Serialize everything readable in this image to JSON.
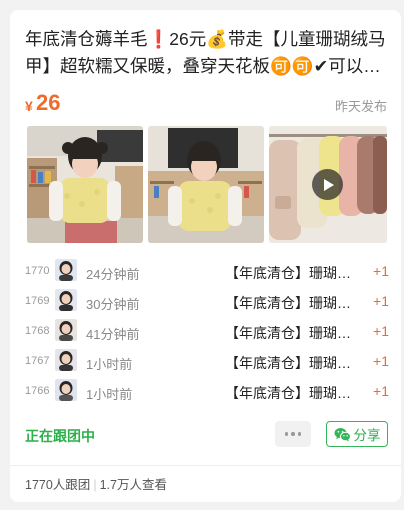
{
  "post": {
    "title": "年底清仓薅羊毛❗26元💰带走【儿童珊瑚绒马甲】超软糯又保暖，叠穿天花板🉑🉑✔可以直接穿也可以叠穿",
    "price_currency": "¥",
    "price_value": "26",
    "publish_time": "昨天发布"
  },
  "images": [
    {
      "name": "photo-child-front"
    },
    {
      "name": "photo-child-side"
    },
    {
      "name": "video-vests-rack",
      "is_video": true
    }
  ],
  "orders": [
    {
      "num": "1770",
      "time": "24分钟前",
      "item": "【年底清仓】珊瑚绒马甲",
      "qty": "+1"
    },
    {
      "num": "1769",
      "time": "30分钟前",
      "item": "【年底清仓】珊瑚绒马甲",
      "qty": "+1"
    },
    {
      "num": "1768",
      "time": "41分钟前",
      "item": "【年底清仓】珊瑚绒马甲",
      "qty": "+1"
    },
    {
      "num": "1767",
      "time": "1小时前",
      "item": "【年底清仓】珊瑚绒马甲",
      "qty": "+1"
    },
    {
      "num": "1766",
      "time": "1小时前",
      "item": "【年底清仓】珊瑚绒马甲",
      "qty": "+1"
    }
  ],
  "actions": {
    "status": "正在跟团中",
    "share_label": "分享"
  },
  "footer": {
    "joined": "1770人跟团",
    "views": "1.7万人查看"
  },
  "colors": {
    "accent_orange": "#f06a2d",
    "accent_green": "#2db04b"
  }
}
